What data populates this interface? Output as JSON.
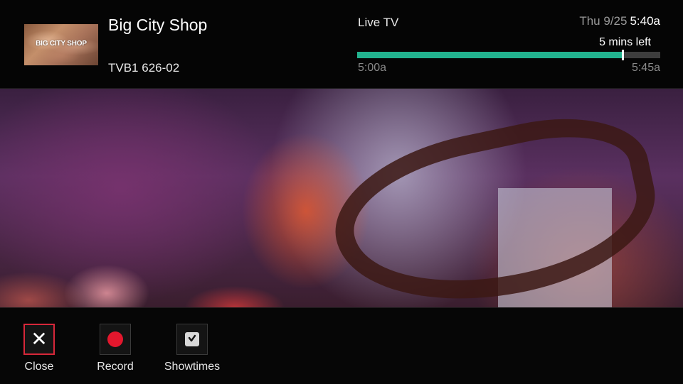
{
  "program": {
    "title": "Big City Shop",
    "thumbnail_text": "BIG CITY SHOP",
    "channel": "TVB1 626-02"
  },
  "status": {
    "live_label": "Live TV",
    "date": "Thu 9/25",
    "time": "5:40a",
    "remaining": "5 mins left"
  },
  "progress": {
    "start": "5:00a",
    "end": "5:45a",
    "fraction": 0.875,
    "fill_color": "#22b38f"
  },
  "actions": [
    {
      "label": "Close",
      "icon": "close-icon",
      "focused": true
    },
    {
      "label": "Record",
      "icon": "record-icon",
      "focused": false
    },
    {
      "label": "Showtimes",
      "icon": "showtimes-icon",
      "focused": false
    }
  ],
  "colors": {
    "accent_focus": "#d7273a",
    "record_red": "#e3172d"
  }
}
